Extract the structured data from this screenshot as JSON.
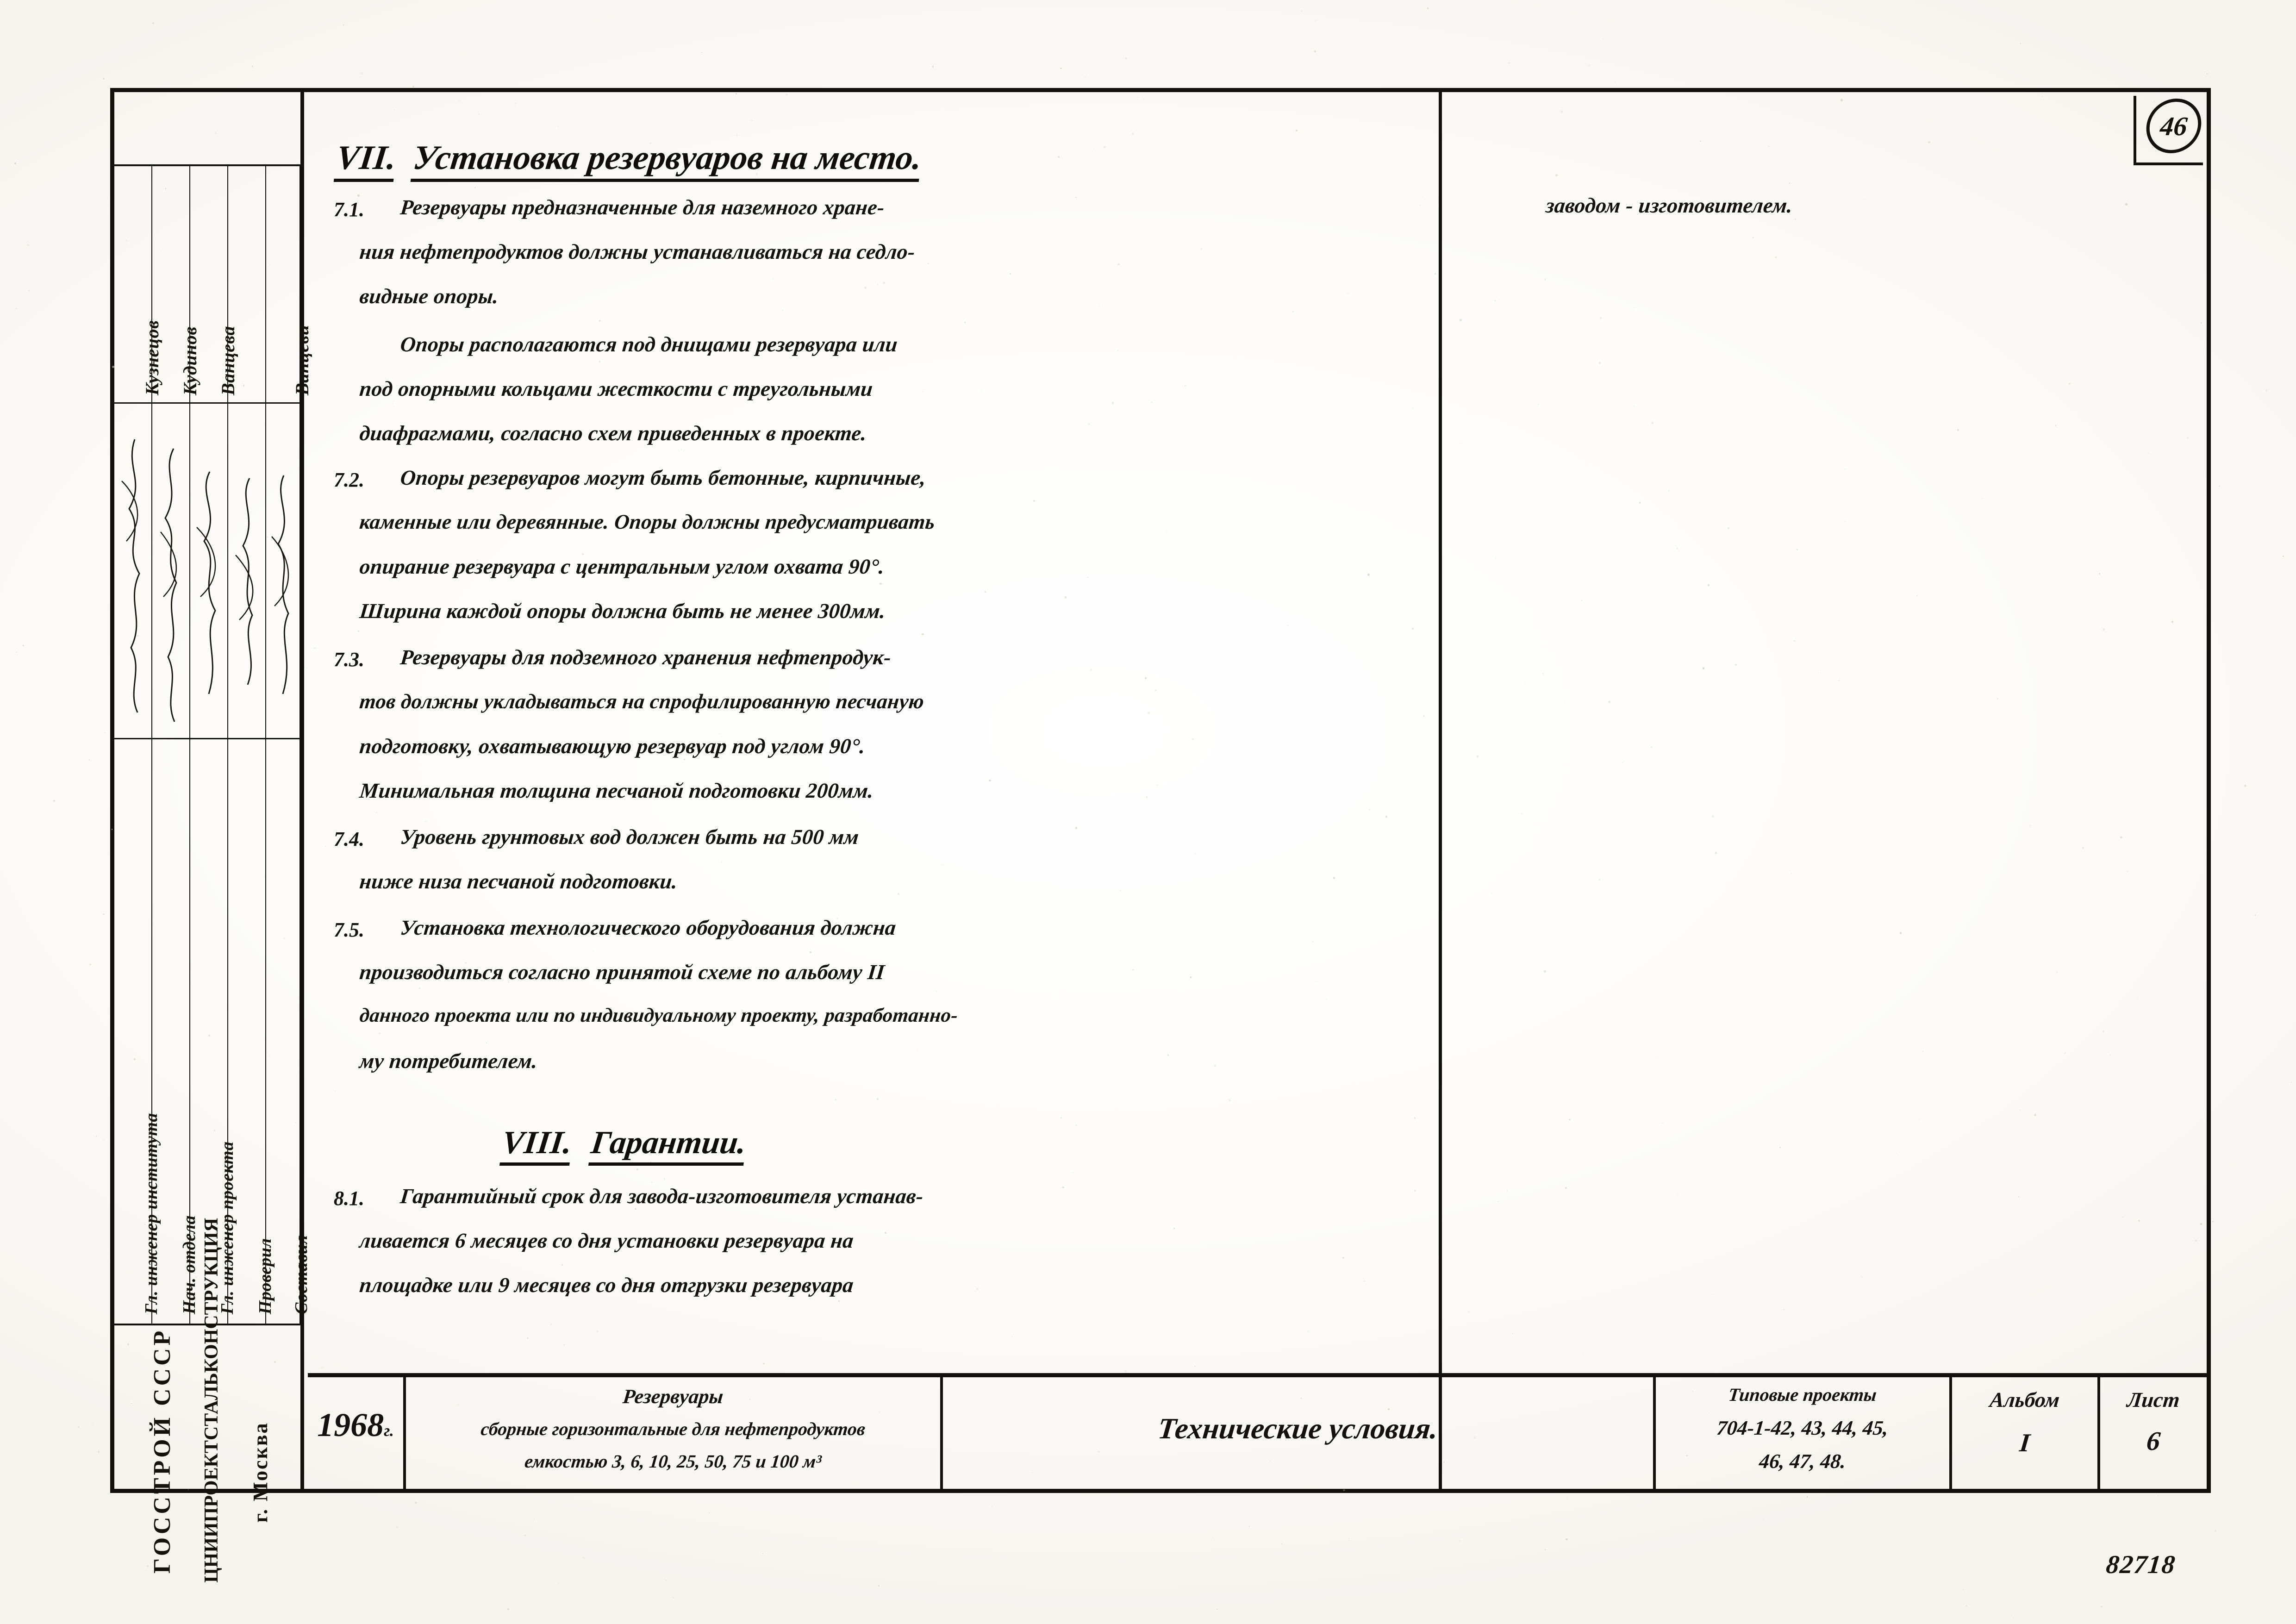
{
  "page": {
    "sheet_badge": "46",
    "doc_code": "82718"
  },
  "sections": [
    {
      "id": "section-7",
      "roman": "VII.",
      "title": "Установка резервуаров на место.",
      "items": [
        {
          "number": "7.1.",
          "lines": [
            "Резервуары предназначенные для наземного хране-",
            "ния нефтепродуктов должны устанавливаться на седло-",
            "видные опоры."
          ]
        },
        {
          "number": "",
          "lines": [
            "Опоры располагаются под днищами резервуара или",
            "под опорными кольцами жесткости с треугольными",
            "диафрагмами, согласно схем приведенных в проекте."
          ]
        },
        {
          "number": "7.2.",
          "lines": [
            "Опоры резервуаров могут быть бетонные, кирпичные,",
            "каменные или деревянные. Опоры должны предусматривать",
            "опирание резервуара с центральным углом охвата 90°.",
            "Ширина каждой опоры должна быть не менее 300мм."
          ]
        },
        {
          "number": "7.3.",
          "lines": [
            "Резервуары для подземного хранения нефтепродук-",
            "тов должны укладываться на спрофилированную песчаную",
            "подготовку, охватывающую резервуар под углом 90°.",
            "Минимальная толщина песчаной подготовки 200мм."
          ]
        },
        {
          "number": "7.4.",
          "lines": [
            "Уровень грунтовых вод должен быть на 500 мм",
            "ниже низа песчаной подготовки."
          ]
        },
        {
          "number": "7.5.",
          "lines": [
            "Установка технологического оборудования должна",
            "производиться согласно принятой схеме по альбому II",
            "данного проекта или по индивидуальному проекту, разработанно-",
            "му потребителем."
          ]
        }
      ]
    },
    {
      "id": "section-8",
      "roman": "VIII.",
      "title": "Гарантии.",
      "items": [
        {
          "number": "8.1.",
          "lines": [
            "Гарантийный срок для завода-изготовителя устанав-",
            "ливается 6 месяцев со дня установки резервуара на",
            "площадке или 9 месяцев со дня отгрузки резервуара"
          ]
        }
      ]
    }
  ],
  "right_column": {
    "continuation": "заводом - изготовителем."
  },
  "stamp": {
    "columns": [
      {
        "role": "Гл. инженер института",
        "name": "Кузнецов"
      },
      {
        "role": "Нач. отдела",
        "name": "Кудинов"
      },
      {
        "role": "Гл. инженер проекта",
        "name": "Ванцева"
      },
      {
        "role": "Проверил",
        "name": ""
      },
      {
        "role": "Составил",
        "name": "Ванцеви"
      }
    ],
    "organization": {
      "authority": "ГОССТРОЙ СССР",
      "institute": "ЦНИИПРОЕКТСТАЛЬКОНСТРУКЦИЯ",
      "city": "г. Москва"
    }
  },
  "title_block": {
    "year": "1968",
    "year_suffix": "г.",
    "object_title": "Резервуары",
    "object_desc_line1": "сборные  горизонтальные для нефтепродуктов",
    "object_desc_line2": "емкостью  3, 6, 10, 25, 50, 75 и 100 м³",
    "drawing_title": "Технические  условия.",
    "project_caption": "Типовые  проекты",
    "project_numbers_line1": "704-1-42, 43, 44, 45,",
    "project_numbers_line2": "46, 47, 48.",
    "album_label": "Альбом",
    "album_value": "I",
    "sheet_label": "Лист",
    "sheet_value": "6"
  }
}
